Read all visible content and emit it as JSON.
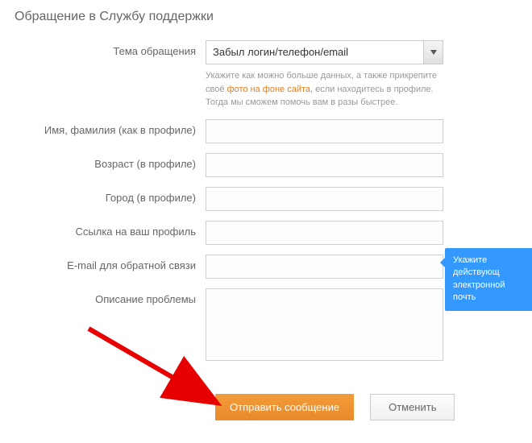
{
  "title": "Обращение в Службу поддержки",
  "fields": {
    "topic": {
      "label": "Тема обращения",
      "selected": "Забыл логин/телефон/email"
    },
    "help": {
      "part1": "Укажите как можно больше данных, а также прикрепите своё ",
      "link": "фото на фоне сайта",
      "part2": ", если находитесь в профиле. Тогда мы сможем помочь вам в разы быстрее."
    },
    "name": {
      "label": "Имя, фамилия (как в профиле)",
      "value": ""
    },
    "age": {
      "label": "Возраст (в профиле)",
      "value": ""
    },
    "city": {
      "label": "Город (в профиле)",
      "value": ""
    },
    "profile_link": {
      "label": "Ссылка на ваш профиль",
      "value": ""
    },
    "email": {
      "label": "E-mail для обратной связи",
      "value": ""
    },
    "description": {
      "label": "Описание проблемы",
      "value": ""
    }
  },
  "tooltip": {
    "line1": "Укажите действующ",
    "line2": "электронной почть"
  },
  "buttons": {
    "submit": "Отправить сообщение",
    "cancel": "Отменить"
  }
}
